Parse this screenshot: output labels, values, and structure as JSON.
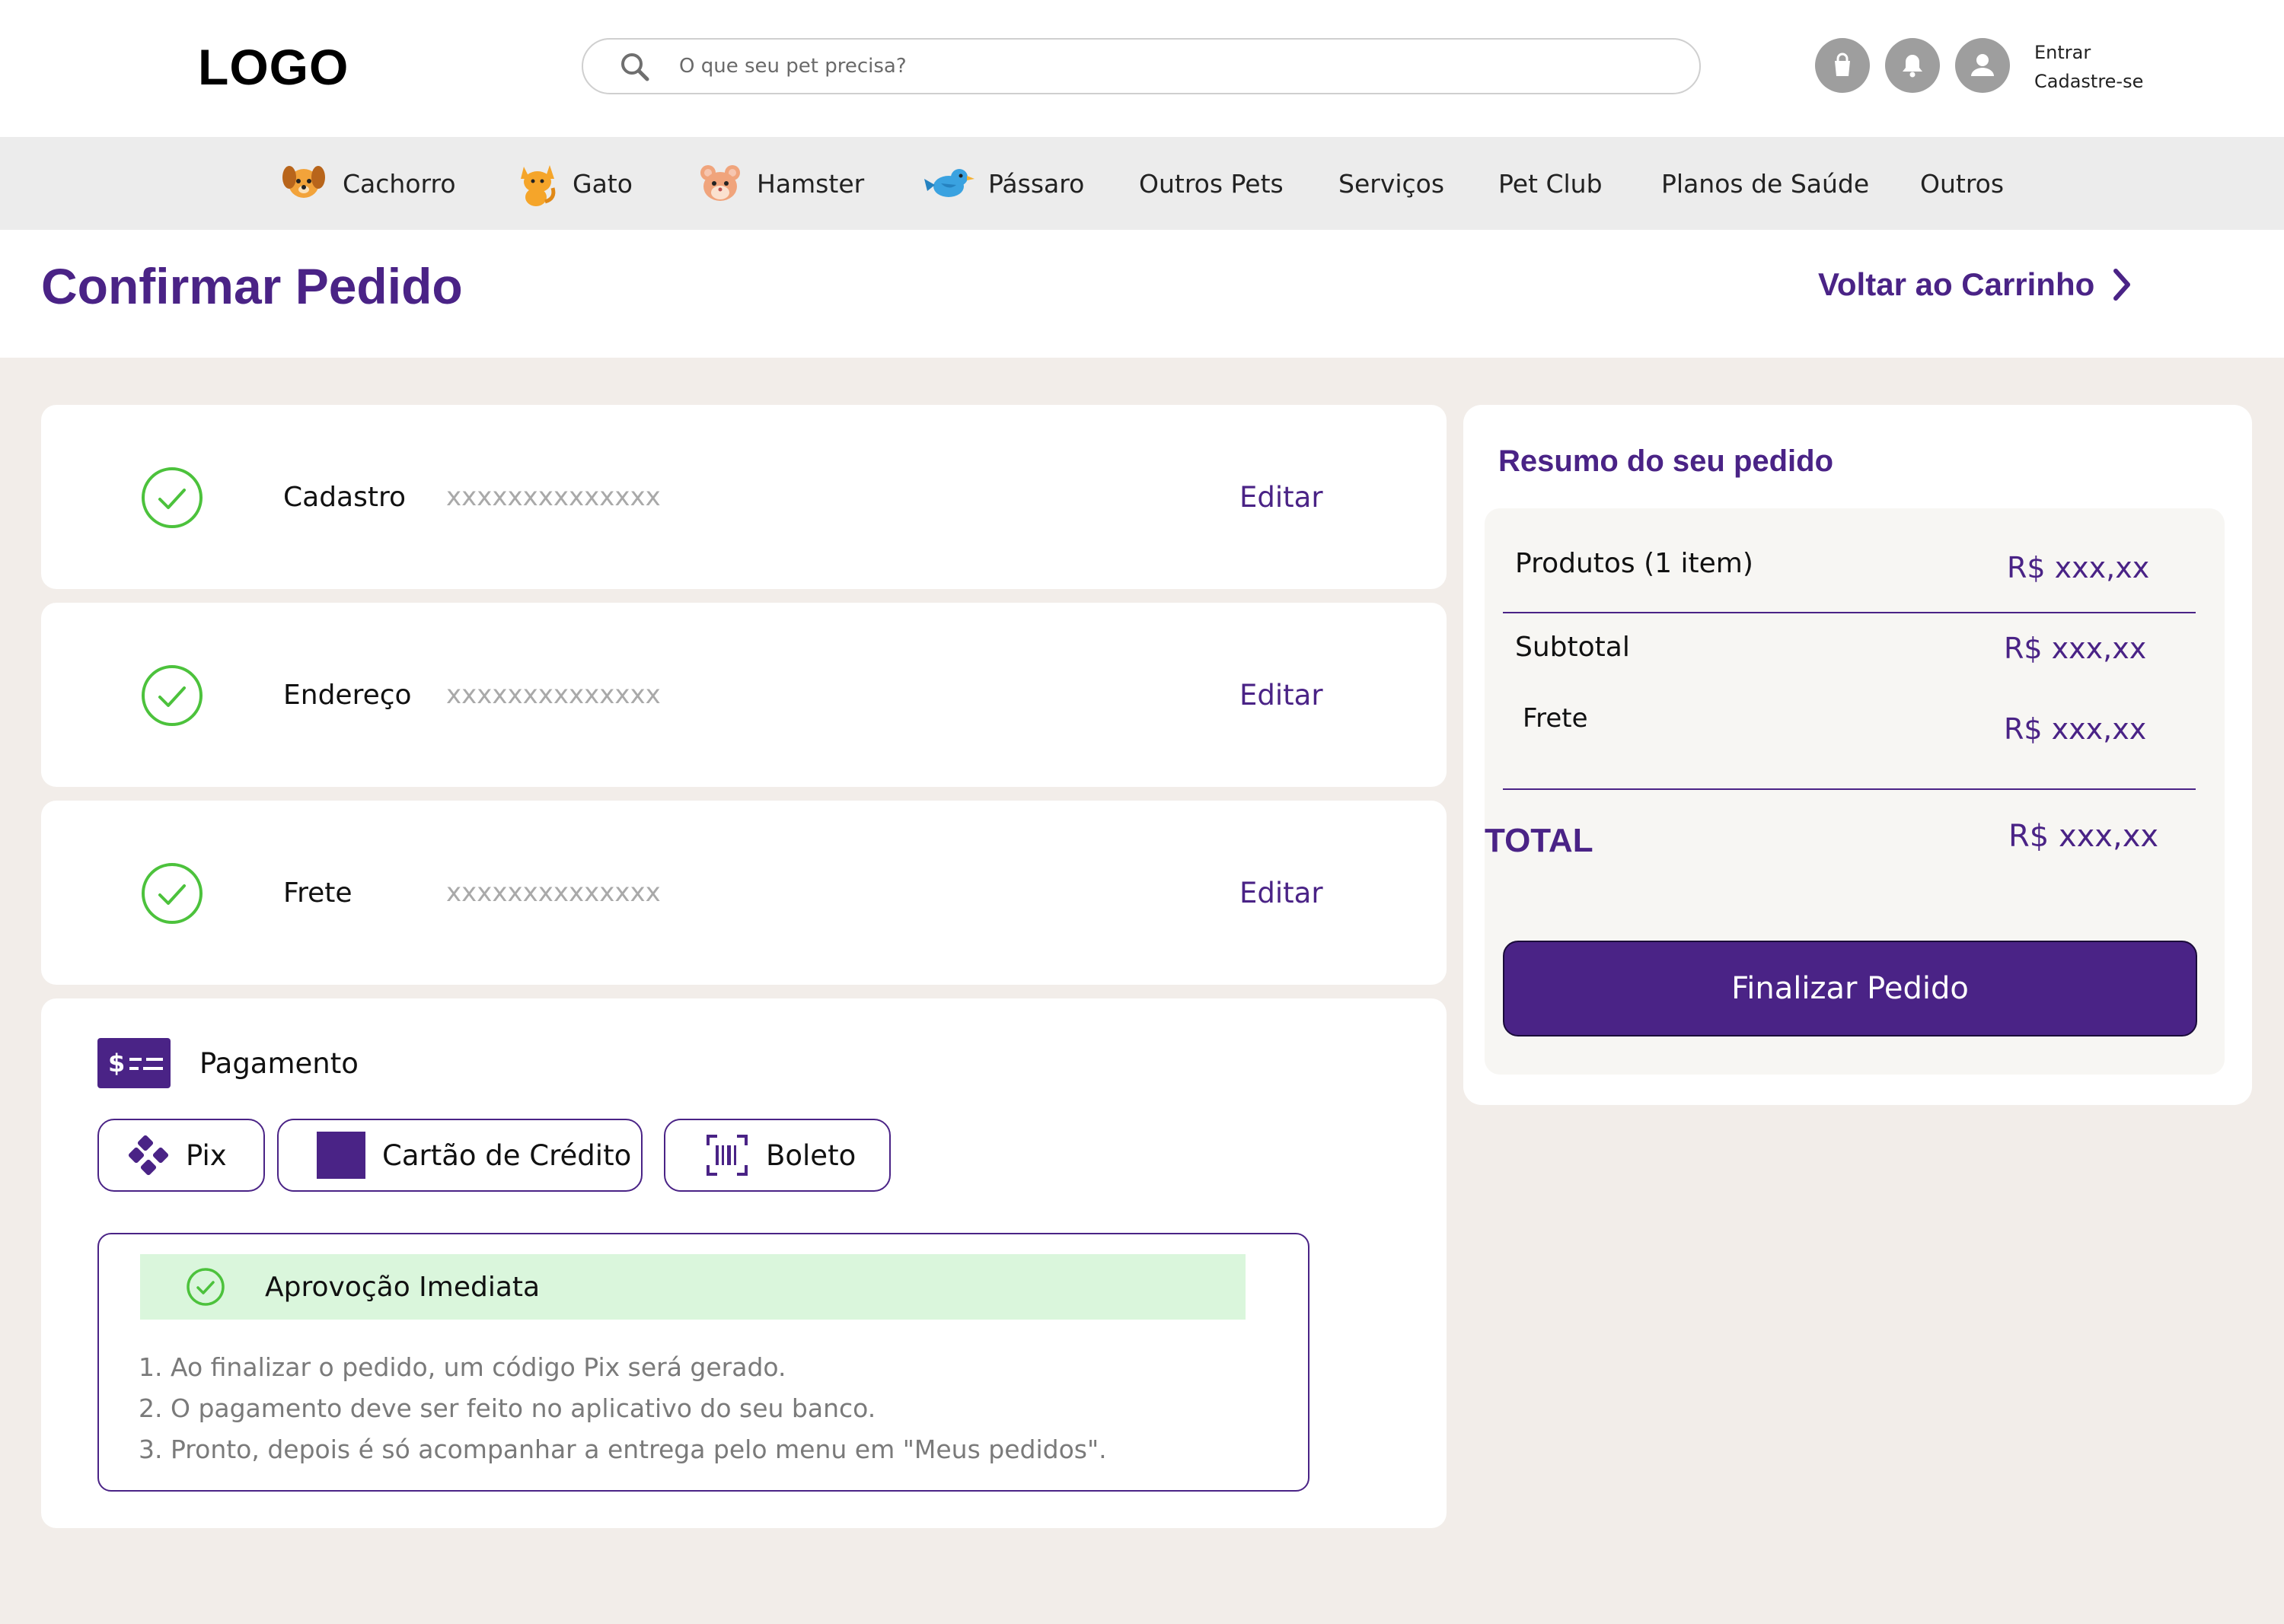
{
  "header": {
    "logo": "LOGO",
    "search": {
      "placeholder": "O que seu pet precisa?",
      "value": ""
    },
    "icons": [
      "shopping-bag-icon",
      "bell-icon",
      "user-icon"
    ],
    "auth": {
      "login": "Entrar",
      "register": "Cadastre-se"
    }
  },
  "nav": {
    "items": [
      {
        "label": "Cachorro",
        "icon": "dog-icon"
      },
      {
        "label": "Gato",
        "icon": "cat-icon"
      },
      {
        "label": "Hamster",
        "icon": "hamster-icon"
      },
      {
        "label": "Pássaro",
        "icon": "bird-icon"
      },
      {
        "label": "Outros Pets"
      },
      {
        "label": "Serviços"
      },
      {
        "label": "Pet Club"
      },
      {
        "label": "Planos de Saúde"
      },
      {
        "label": "Outros"
      }
    ]
  },
  "page": {
    "title": "Confirmar Pedido",
    "back_link": "Voltar ao Carrinho"
  },
  "steps": [
    {
      "label": "Cadastro",
      "value": "xxxxxxxxxxxxxx",
      "edit": "Editar",
      "status": "complete"
    },
    {
      "label": "Endereço",
      "value": "xxxxxxxxxxxxxx",
      "edit": "Editar",
      "status": "complete"
    },
    {
      "label": "Frete",
      "value": "xxxxxxxxxxxxxx",
      "edit": "Editar",
      "status": "complete"
    }
  ],
  "payment": {
    "label": "Pagamento",
    "options": [
      {
        "label": "Pix",
        "icon": "pix-icon",
        "selected": true
      },
      {
        "label": "Cartão de Crédito",
        "icon": "credit-card-icon"
      },
      {
        "label": "Boleto",
        "icon": "barcode-icon"
      }
    ],
    "approval": "Aprovoção Imediata",
    "instructions": [
      "1. Ao finalizar o pedido, um código Pix será gerado.",
      "2. O pagamento deve ser feito no aplicativo do seu banco.",
      "3. Pronto, depois é só acompanhar a entrega pelo menu em \"Meus pedidos\"."
    ]
  },
  "summary": {
    "title": "Resumo do seu pedido",
    "products_label": "Produtos (1 item)",
    "products_value": "R$ xxx,xx",
    "subtotal_label": "Subtotal",
    "subtotal_value": "R$ xxx,xx",
    "shipping_label": "Frete",
    "shipping_value": "R$ xxx,xx",
    "total_label": "TOTAL",
    "total_value": "R$ xxx,xx",
    "finalize_button": "Finalizar Pedido"
  },
  "colors": {
    "brand": "#4a2386",
    "success": "#4cc23c",
    "approval_bg": "#daf6dc",
    "background": "#f2ede9"
  }
}
